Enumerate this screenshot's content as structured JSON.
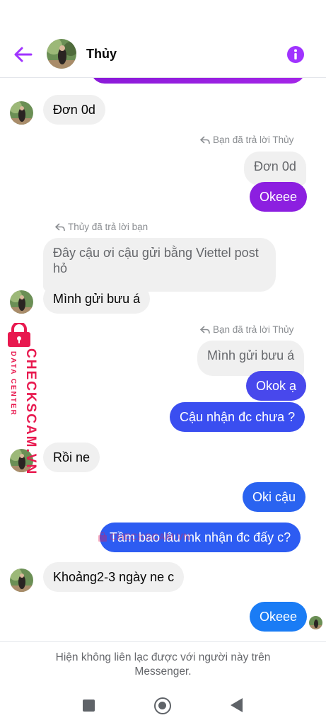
{
  "header": {
    "contact_name": "Thủy",
    "back_icon": "back-arrow-icon",
    "info_icon": "info-icon"
  },
  "colors": {
    "accent": "#a033ff",
    "purple_bubble": "#8c1fe0",
    "blue_bubble": "#3a4ef0",
    "light_blue_bubble": "#1a7cf5",
    "incoming_bubble": "#f0f0f0"
  },
  "messages": {
    "m1": "Đơn 0d",
    "reply_note_1": "Bạn đã trả lời Thủy",
    "quote_1": "Đơn 0d",
    "m2": "Okeee",
    "reply_note_2": "Thủy đã trả lời bạn",
    "quote_2_line1": "Đây cậu ơi cậu gửi bằng Viettel post",
    "quote_2_line2": "hỏ",
    "m3": "Mình gửi bưu á",
    "reply_note_3": "Bạn đã trả lời Thủy",
    "quote_3": "Mình gửi bưu á",
    "m4": "Okok ạ",
    "m5": "Cậu nhận đc chưa ?",
    "m6": "Rồi ne",
    "m7": "Oki cậu",
    "m8": "Tầm bao lâu mk nhận đc đấy c?",
    "m9": "Khoảng2-3 ngày ne c",
    "m10": "Okeee"
  },
  "footer": {
    "notice": "Hiện không liên lạc được với người này trên Messenger."
  },
  "watermark": {
    "brand": "CHECKSCAM.VN",
    "sub": "DATA CENTER",
    "center_text": "CHECKSCAM.VN"
  },
  "navbar": {
    "recents_icon": "recents-square-icon",
    "home_icon": "home-circle-icon",
    "back_icon": "back-triangle-icon"
  }
}
